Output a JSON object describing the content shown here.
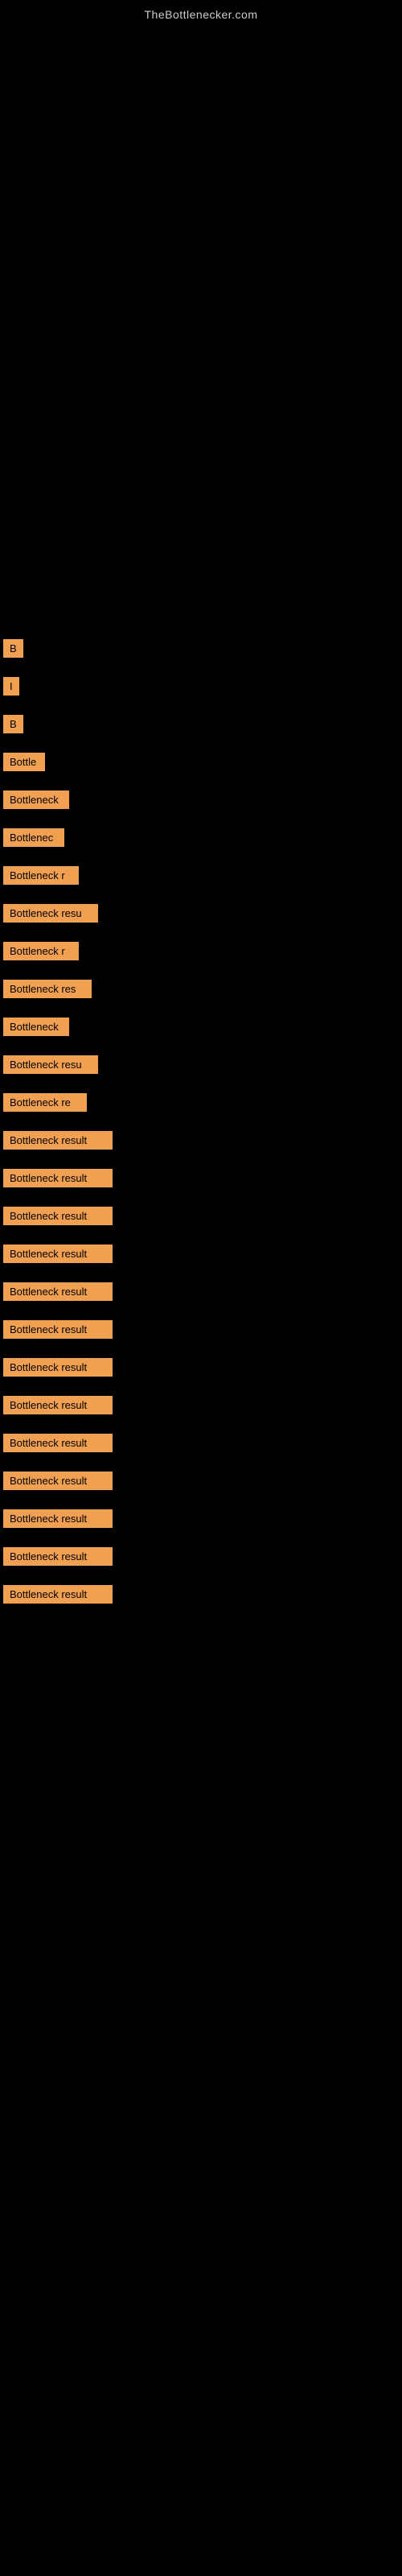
{
  "site": {
    "title": "TheBottlenecker.com"
  },
  "bottleneck_items": [
    {
      "id": 1,
      "label": "B",
      "width": 18
    },
    {
      "id": 2,
      "label": "I",
      "width": 12
    },
    {
      "id": 3,
      "label": "B",
      "width": 18
    },
    {
      "id": 4,
      "label": "Bottle",
      "width": 52
    },
    {
      "id": 5,
      "label": "Bottleneck",
      "width": 82
    },
    {
      "id": 6,
      "label": "Bottlenec",
      "width": 76
    },
    {
      "id": 7,
      "label": "Bottleneck r",
      "width": 94
    },
    {
      "id": 8,
      "label": "Bottleneck resu",
      "width": 118
    },
    {
      "id": 9,
      "label": "Bottleneck r",
      "width": 94
    },
    {
      "id": 10,
      "label": "Bottleneck res",
      "width": 110
    },
    {
      "id": 11,
      "label": "Bottleneck",
      "width": 82
    },
    {
      "id": 12,
      "label": "Bottleneck resu",
      "width": 118
    },
    {
      "id": 13,
      "label": "Bottleneck re",
      "width": 104
    },
    {
      "id": 14,
      "label": "Bottleneck result",
      "width": 136
    },
    {
      "id": 15,
      "label": "Bottleneck result",
      "width": 136
    },
    {
      "id": 16,
      "label": "Bottleneck result",
      "width": 136
    },
    {
      "id": 17,
      "label": "Bottleneck result",
      "width": 136
    },
    {
      "id": 18,
      "label": "Bottleneck result",
      "width": 136
    },
    {
      "id": 19,
      "label": "Bottleneck result",
      "width": 136
    },
    {
      "id": 20,
      "label": "Bottleneck result",
      "width": 136
    },
    {
      "id": 21,
      "label": "Bottleneck result",
      "width": 136
    },
    {
      "id": 22,
      "label": "Bottleneck result",
      "width": 136
    },
    {
      "id": 23,
      "label": "Bottleneck result",
      "width": 136
    },
    {
      "id": 24,
      "label": "Bottleneck result",
      "width": 136
    },
    {
      "id": 25,
      "label": "Bottleneck result",
      "width": 136
    },
    {
      "id": 26,
      "label": "Bottleneck result",
      "width": 136
    }
  ]
}
